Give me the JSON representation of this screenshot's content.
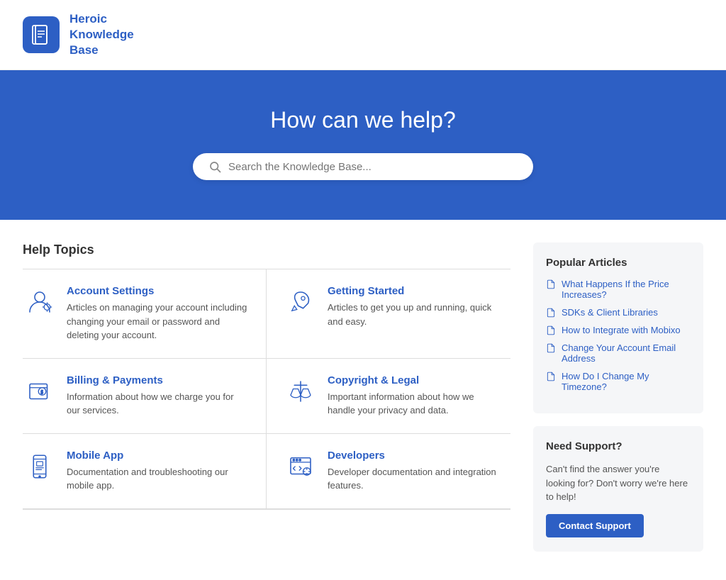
{
  "header": {
    "logo_alt": "Heroic Knowledge Base",
    "logo_line1": "Heroic",
    "logo_line2": "Knowledge",
    "logo_line3": "Base"
  },
  "hero": {
    "heading": "How can we help?",
    "search_placeholder": "Search the Knowledge Base..."
  },
  "topics_section": {
    "heading": "Help Topics",
    "topics": [
      {
        "id": "account-settings",
        "title": "Account Settings",
        "description": "Articles on managing your account including changing your email or password and deleting your account.",
        "icon": "user"
      },
      {
        "id": "getting-started",
        "title": "Getting Started",
        "description": "Articles to get you up and running, quick and easy.",
        "icon": "rocket"
      },
      {
        "id": "billing-payments",
        "title": "Billing & Payments",
        "description": "Information about how we charge you for our services.",
        "icon": "billing"
      },
      {
        "id": "copyright-legal",
        "title": "Copyright & Legal",
        "description": "Important information about how we handle your privacy and data.",
        "icon": "legal"
      },
      {
        "id": "mobile-app",
        "title": "Mobile App",
        "description": "Documentation and troubleshooting our mobile app.",
        "icon": "mobile"
      },
      {
        "id": "developers",
        "title": "Developers",
        "description": "Developer documentation and integration features.",
        "icon": "code"
      }
    ]
  },
  "sidebar": {
    "popular_articles": {
      "heading": "Popular Articles",
      "articles": [
        "What Happens If the Price Increases?",
        "SDKs & Client Libraries",
        "How to Integrate with Mobixo",
        "Change Your Account Email Address",
        "How Do I Change My Timezone?"
      ]
    },
    "need_support": {
      "heading": "Need Support?",
      "text": "Can't find the answer you're looking for? Don't worry we're here to help!",
      "button_label": "Contact Support"
    }
  }
}
